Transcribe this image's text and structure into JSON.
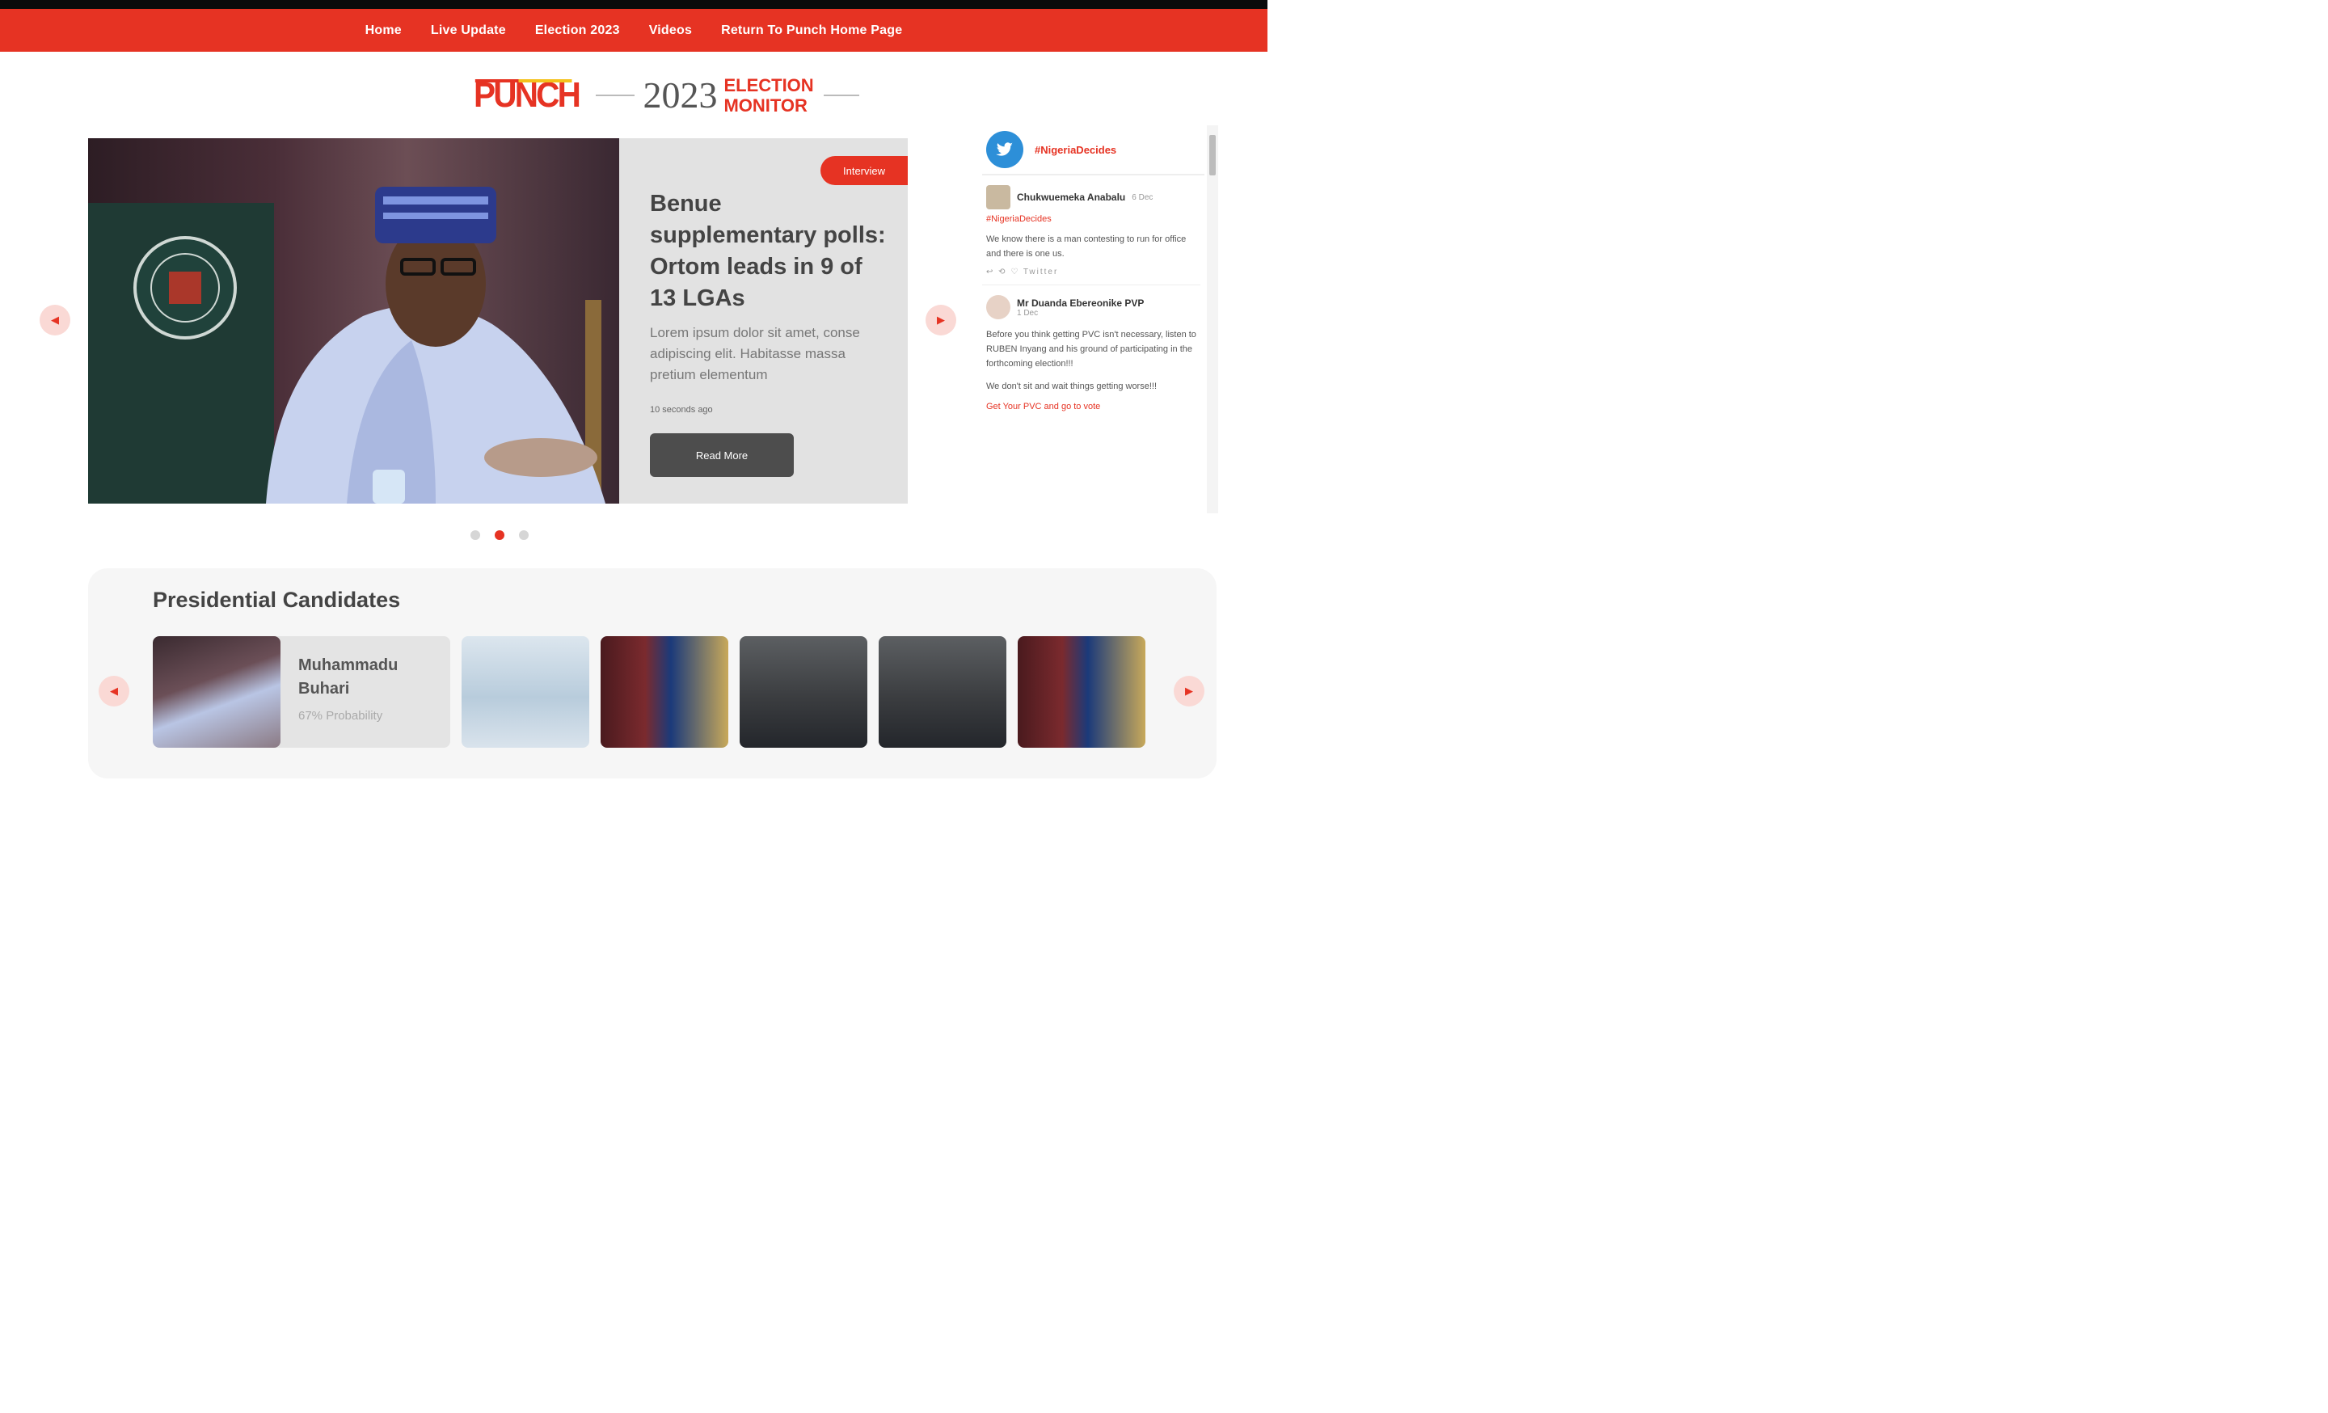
{
  "nav": {
    "items": [
      {
        "label": "Home"
      },
      {
        "label": "Live Update"
      },
      {
        "label": "Election 2023"
      },
      {
        "label": "Videos"
      },
      {
        "label": "Return To Punch Home Page"
      }
    ]
  },
  "brand": {
    "logo": "PUNCH",
    "year": "2023",
    "line1": "ELECTION",
    "line2": "MONITOR"
  },
  "hero": {
    "tag": "Interview",
    "title": "Benue supplementary polls: Ortom leads in 9 of 13 LGAs",
    "excerpt": "Lorem ipsum dolor sit amet, conse adipiscing elit. Habitasse massa pretium elementum",
    "time": "10 seconds ago",
    "read_more": "Read More",
    "slides": 3,
    "active_slide": 2
  },
  "twitter": {
    "hashtag": "#NigeriaDecides",
    "tweets": [
      {
        "name": "Chukwuemeka Anabalu",
        "time": "6 Dec",
        "tag": "#NigeriaDecides",
        "text": "We know there is a man contesting to run for office and there is one us.",
        "meta": "↩ ⟲ ♡ Twitter"
      },
      {
        "name": "Mr Duanda Ebereonike PVP",
        "time": "1 Dec",
        "text": "Before you think getting PVC isn't necessary, listen to RUBEN Inyang and his ground of participating in the forthcoming election!!!",
        "text2": "We don't sit and wait things getting worse!!!",
        "link": "Get Your PVC and go to vote"
      }
    ]
  },
  "candidates": {
    "title": "Presidential Candidates",
    "featured": {
      "name": "Muhammadu Buhari",
      "probability": "67% Probability"
    }
  },
  "colors": {
    "brand_red": "#e63323",
    "dark_button": "#4d4d4d",
    "twitter_blue": "#2d8fd8"
  }
}
